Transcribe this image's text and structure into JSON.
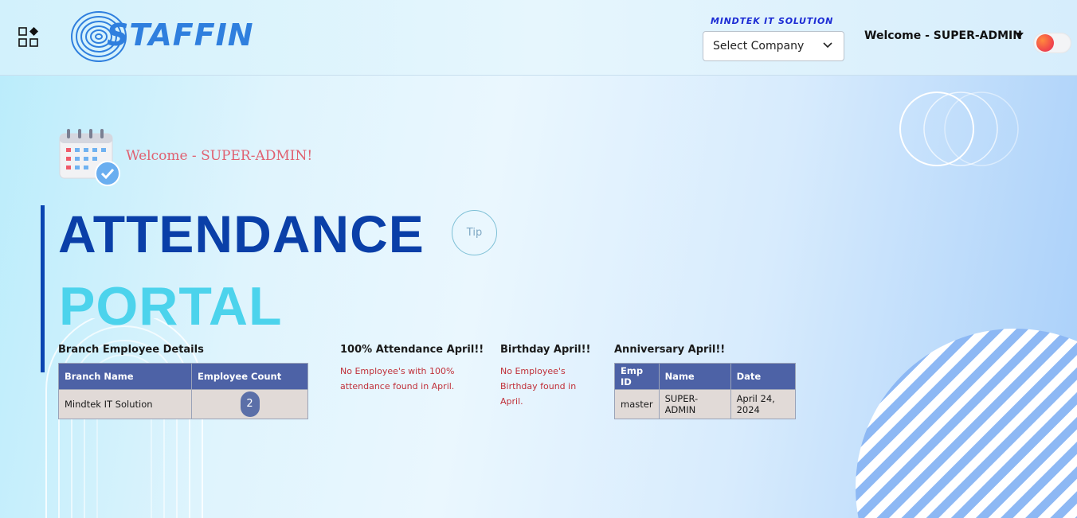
{
  "header": {
    "logo_text": "STAFFIN",
    "company_label": "MINDTEK IT SOLUTION",
    "company_select_value": "Select Company",
    "welcome": "Welcome - SUPER-ADMIN"
  },
  "main": {
    "welcome_message": "Welcome - SUPER-ADMIN!",
    "title_line1": "ATTENDANCE",
    "title_line2": "PORTAL",
    "tip_label": "Tip"
  },
  "branch": {
    "title": "Branch Employee Details",
    "columns": [
      "Branch Name",
      "Employee Count"
    ],
    "rows": [
      {
        "name": "Mindtek IT Solution",
        "count": "2"
      }
    ]
  },
  "attendance": {
    "title": "100% Attendance April!!",
    "note_line1": "No Employee's with 100%",
    "note_line2": "attendance found in April."
  },
  "birthday": {
    "title": "Birthday April!!",
    "note_line1": "No Employee's",
    "note_line2": "Birthday found in",
    "note_line3": "April."
  },
  "anniversary": {
    "title": "Anniversary April!!",
    "columns": [
      "Emp ID",
      "Name",
      "Date"
    ],
    "rows": [
      {
        "emp_id": "master",
        "name": "SUPER-ADMIN",
        "date": "April 24, 2024"
      }
    ]
  },
  "colors": {
    "title_dark": "#0a3fa8",
    "title_light": "#4cd3ec",
    "table_header": "#4d62a6",
    "table_cell": "#e1dad7",
    "note_red": "#c0303a"
  },
  "icons": [
    "grid-menu-icon",
    "fingerprint-logo-icon",
    "chevron-down-icon",
    "caret-down-icon",
    "calendar-check-icon"
  ]
}
